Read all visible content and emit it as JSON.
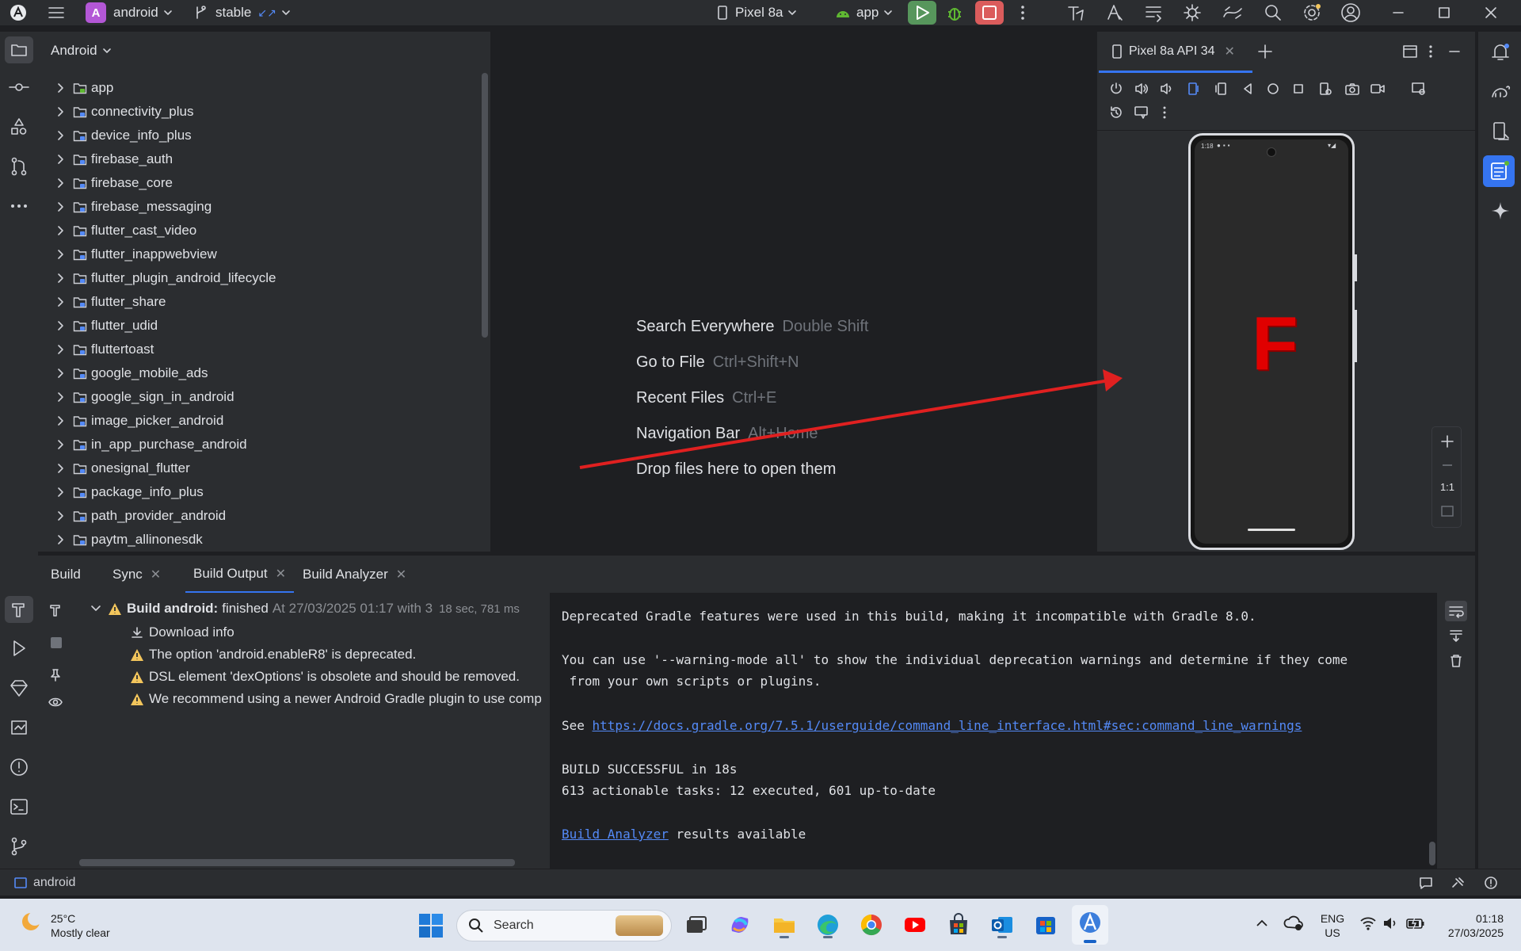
{
  "titlebar": {
    "project_initial": "A",
    "project_name": "android",
    "branch": "stable",
    "device": "Pixel 8a",
    "run_config": "app"
  },
  "project_panel": {
    "view_mode": "Android",
    "modules": [
      "app",
      "connectivity_plus",
      "device_info_plus",
      "firebase_auth",
      "firebase_core",
      "firebase_messaging",
      "flutter_cast_video",
      "flutter_inappwebview",
      "flutter_plugin_android_lifecycle",
      "flutter_share",
      "flutter_udid",
      "fluttertoast",
      "google_mobile_ads",
      "google_sign_in_android",
      "image_picker_android",
      "in_app_purchase_android",
      "onesignal_flutter",
      "package_info_plus",
      "path_provider_android",
      "paytm_allinonesdk"
    ]
  },
  "editor_hints": [
    {
      "label": "Search Everywhere",
      "key": "Double Shift"
    },
    {
      "label": "Go to File",
      "key": "Ctrl+Shift+N"
    },
    {
      "label": "Recent Files",
      "key": "Ctrl+E"
    },
    {
      "label": "Navigation Bar",
      "key": "Alt+Home"
    },
    {
      "label": "Drop files here to open them",
      "key": ""
    }
  ],
  "devices_panel": {
    "tab_label": "Pixel 8a API 34",
    "phone_time": "1:18",
    "app_glyph": "F",
    "zoom_label": "1:1",
    "colors": {
      "app_glyph": "#e00000",
      "annotation_arrow": "#e02020"
    }
  },
  "build": {
    "tabs": [
      "Build",
      "Sync",
      "Build Output",
      "Build Analyzer"
    ],
    "tree": {
      "root_label": "Build android:",
      "root_status": "finished",
      "root_detail": "At 27/03/2025 01:17 with 3",
      "root_duration": "18 sec, 781 ms",
      "items": [
        {
          "icon": "download-icon",
          "text": "Download info"
        },
        {
          "icon": "warning-icon",
          "text": "The option 'android.enableR8' is deprecated."
        },
        {
          "icon": "warning-icon",
          "text": "DSL element 'dexOptions' is obsolete and should be removed."
        },
        {
          "icon": "warning-icon",
          "text": "We recommend using a newer Android Gradle plugin to use comp"
        }
      ]
    },
    "console": {
      "line1": "Deprecated Gradle features were used in this build, making it incompatible with Gradle 8.0.",
      "line2": "You can use '--warning-mode all' to show the individual deprecation warnings and determine if they come",
      "line3": " from your own scripts or plugins.",
      "see_prefix": "See ",
      "see_link": "https://docs.gradle.org/7.5.1/userguide/command_line_interface.html#sec:command_line_warnings",
      "line5": "BUILD SUCCESSFUL in 18s",
      "line6": "613 actionable tasks: 12 executed, 601 up-to-date",
      "analyzer_link": "Build Analyzer",
      "analyzer_suffix": " results available"
    }
  },
  "statusbar": {
    "project": "android"
  },
  "taskbar": {
    "weather_temp": "25°C",
    "weather_desc": "Mostly clear",
    "search_placeholder": "Search",
    "lang_top": "ENG",
    "lang_bottom": "US",
    "time": "01:18",
    "date": "27/03/2025"
  }
}
